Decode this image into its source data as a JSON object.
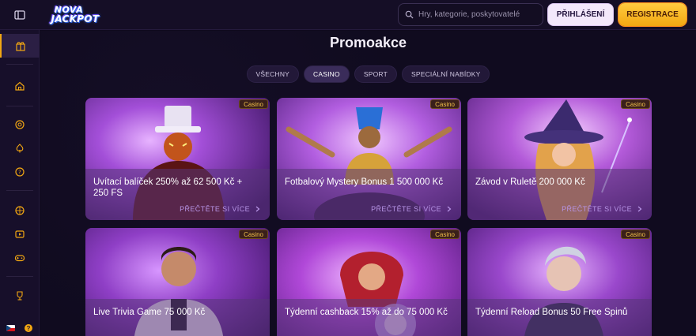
{
  "brand": {
    "line1": "NOVA",
    "line2": "JACKPOT"
  },
  "search": {
    "placeholder": "Hry, kategorie, poskytovatelé"
  },
  "header": {
    "login_label": "PŘIHLÁŠENÍ",
    "register_label": "REGISTRACE"
  },
  "page": {
    "title": "Promoakce"
  },
  "tabs": [
    {
      "label": "VŠECHNY",
      "active": false
    },
    {
      "label": "CASINO",
      "active": true
    },
    {
      "label": "SPORT",
      "active": false
    },
    {
      "label": "SPECIÁLNÍ NABÍDKY",
      "active": false
    }
  ],
  "sidebar": {
    "items": [
      {
        "icon": "gift-icon",
        "active": true
      },
      {
        "icon": "home-icon"
      },
      {
        "icon": "casino-chip-icon"
      },
      {
        "icon": "spade-icon"
      },
      {
        "icon": "question-icon"
      },
      {
        "icon": "roulette-icon"
      },
      {
        "icon": "play-icon"
      },
      {
        "icon": "gamepad-icon"
      },
      {
        "icon": "trophy-icon"
      }
    ],
    "language_flag": "cz-flag-icon",
    "help_label": "?"
  },
  "promos": [
    {
      "badge": "Casino",
      "title": "Uvítací balíček 250% až 62 500 Kč + 250 FS",
      "more": "PŘEČTĚTE SI VÍCE",
      "art": "#7a2fb0"
    },
    {
      "badge": "Casino",
      "title": "Fotbalový Mystery Bonus 1 500 000 Kč",
      "more": "PŘEČTĚTE SI VÍCE",
      "art": "#8e3cc0"
    },
    {
      "badge": "Casino",
      "title": "Závod v Ruletě 200 000 Kč",
      "more": "PŘEČTĚTE SI VÍCE",
      "art": "#8a36b8"
    },
    {
      "badge": "Casino",
      "title": "Live Trivia Game 75 000 Kč",
      "more": "",
      "art": "#7b2ea8"
    },
    {
      "badge": "Casino",
      "title": "Týdenní cashback 15% až do 75 000 Kč",
      "more": "",
      "art": "#8b38b5"
    },
    {
      "badge": "Casino",
      "title": "Týdenní Reload Bonus 50 Free Spinů",
      "more": "",
      "art": "#7d36aa"
    }
  ],
  "colors": {
    "accent": "#f2a712",
    "bg": "#100b1f",
    "card": "#7a2fb0"
  }
}
